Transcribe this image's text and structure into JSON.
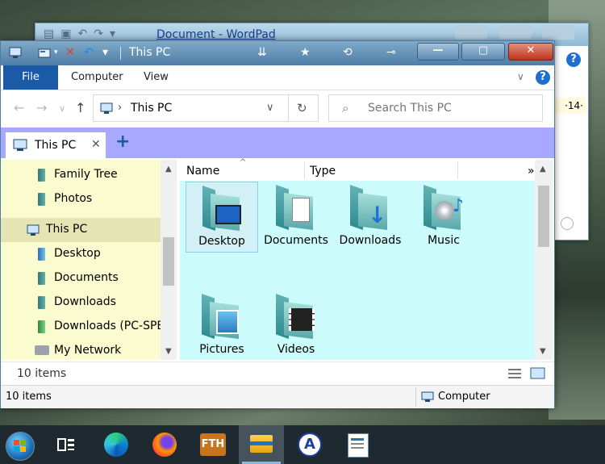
{
  "wordpad": {
    "title": "Document - WordPad",
    "help": "?",
    "ruler_value": "·14·"
  },
  "explorer": {
    "title": "This PC",
    "ribbon": {
      "file": "File",
      "computer": "Computer",
      "view": "View",
      "help": "?"
    },
    "address": {
      "location": "This PC"
    },
    "search": {
      "placeholder": "Search This PC"
    },
    "tab": {
      "label": "This PC",
      "close": "✕",
      "new": "+"
    },
    "nav": {
      "items": [
        {
          "label": "Family Tree"
        },
        {
          "label": "Photos"
        },
        {
          "label": "This PC"
        },
        {
          "label": "Desktop"
        },
        {
          "label": "Documents"
        },
        {
          "label": "Downloads"
        },
        {
          "label": "Downloads (PC-SPEC"
        },
        {
          "label": "My Network"
        }
      ]
    },
    "columns": {
      "name": "Name",
      "type": "Type",
      "more": "»"
    },
    "folders": [
      {
        "label": "Desktop"
      },
      {
        "label": "Documents"
      },
      {
        "label": "Downloads"
      },
      {
        "label": "Music"
      },
      {
        "label": "Pictures"
      },
      {
        "label": "Videos"
      }
    ],
    "status_top": "10 items",
    "status_bottom": "10 items",
    "status_location": "Computer"
  },
  "taskbar": {
    "apps": [
      "start",
      "task-view",
      "edge",
      "firefox",
      "fth",
      "file-explorer",
      "atom-app",
      "wordpad"
    ],
    "fth_label": "FTH"
  },
  "colors": {
    "title_blue": "#4f7ea6",
    "tabs_bar": "#a6a9ff",
    "nav_bg": "#fbfbd0",
    "content_bg": "#ccfbfb",
    "file_tab": "#1a5aa6"
  }
}
